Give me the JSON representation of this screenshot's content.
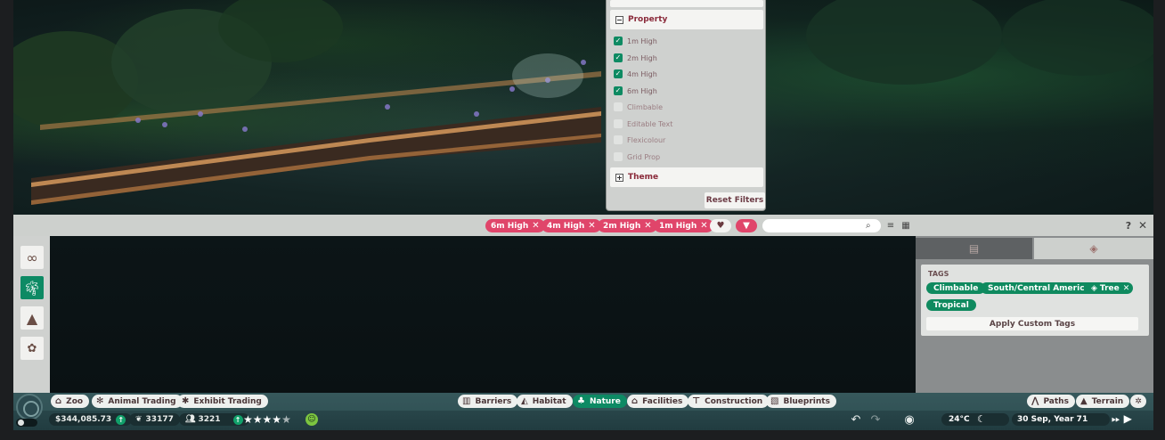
{
  "property_panel": {
    "header": "Property",
    "items": [
      {
        "label": "1m High",
        "checked": true
      },
      {
        "label": "2m High",
        "checked": true
      },
      {
        "label": "4m High",
        "checked": true
      },
      {
        "label": "6m High",
        "checked": true
      },
      {
        "label": "Climbable",
        "checked": false
      },
      {
        "label": "Editable Text",
        "checked": false
      },
      {
        "label": "Flexicolour",
        "checked": false
      },
      {
        "label": "Grid Prop",
        "checked": false
      }
    ],
    "theme_header": "Theme",
    "reset_label": "Reset Filters"
  },
  "filter_bar": {
    "chips": [
      "6m High",
      "4m High",
      "2m High",
      "1m High"
    ],
    "search_placeholder": "",
    "help_label": "?",
    "close_label": "✕"
  },
  "side_tabs": [
    "infinity-icon",
    "tree-icon",
    "rock-icon",
    "fence-icon"
  ],
  "tags": {
    "title": "TAGS",
    "items": [
      "Climbable",
      "South/Central America",
      "Tree",
      "Tropical"
    ],
    "apply_label": "Apply Custom Tags"
  },
  "toolbar": {
    "left": [
      {
        "label": "Zoo",
        "icon": "zoo-icon"
      },
      {
        "label": "Animal Trading",
        "icon": "paw-icon"
      },
      {
        "label": "Exhibit Trading",
        "icon": "bug-icon"
      }
    ],
    "center": [
      {
        "label": "Barriers",
        "icon": "barrier-icon",
        "active": false
      },
      {
        "label": "Habitat",
        "icon": "habitat-icon",
        "active": false
      },
      {
        "label": "Nature",
        "icon": "nature-icon",
        "active": true
      },
      {
        "label": "Facilities",
        "icon": "facilities-icon",
        "active": false
      },
      {
        "label": "Construction",
        "icon": "construction-icon",
        "active": false
      },
      {
        "label": "Blueprints",
        "icon": "blueprints-icon",
        "active": false
      }
    ],
    "right": [
      {
        "label": "Paths",
        "icon": "paths-icon"
      },
      {
        "label": "Terrain",
        "icon": "terrain-icon"
      }
    ]
  },
  "status": {
    "money": "$344,085.73",
    "conservation": "33177",
    "guests": "3221",
    "rating_stars": 4.5,
    "temperature": "24°C",
    "date": "30 Sep, Year 71"
  },
  "colors": {
    "accent_green": "#0d8a64",
    "chip_pink": "#e0456a"
  }
}
